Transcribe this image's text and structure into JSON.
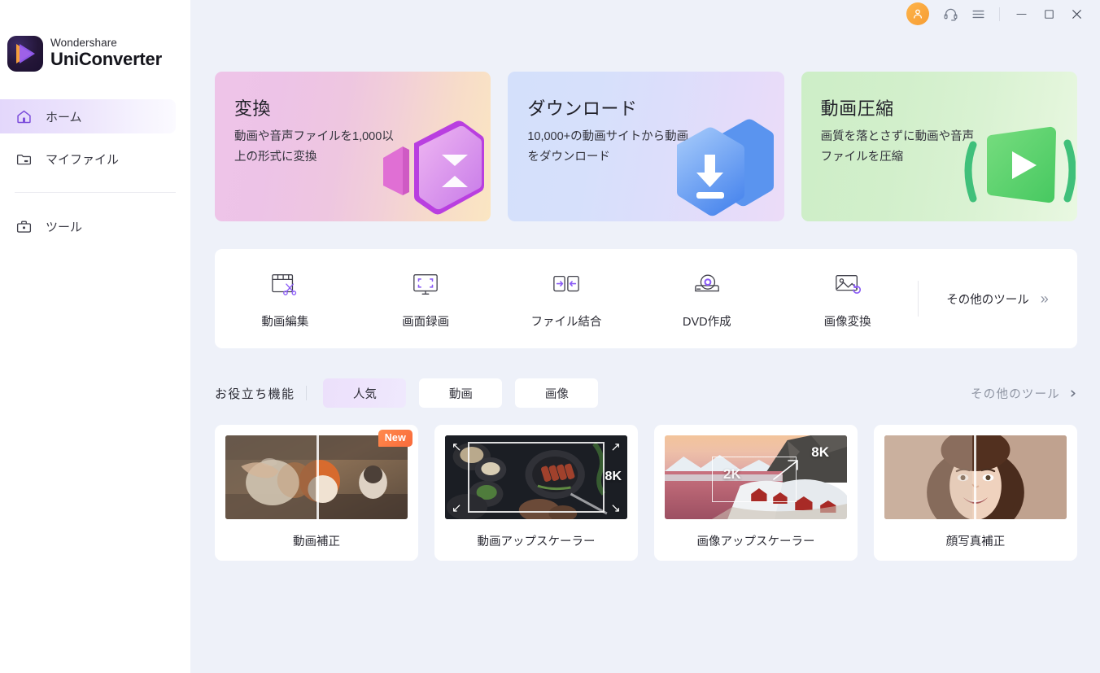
{
  "app": {
    "brand_top": "Wondershare",
    "brand_bottom": "UniConverter",
    "background_color": "#eef1f9",
    "accent_color": "#8b5cf6"
  },
  "titlebar": {
    "avatar_icon": "user-avatar-icon",
    "avatar_color": "#f9a53a",
    "support_icon": "headset-icon",
    "menu_icon": "hamburger-menu-icon",
    "minimize_icon": "minimize-icon",
    "maximize_icon": "maximize-icon",
    "close_icon": "close-icon"
  },
  "sidebar": {
    "items": [
      {
        "label": "ホーム",
        "icon": "home-icon",
        "active": true
      },
      {
        "label": "マイファイル",
        "icon": "folder-icon",
        "active": false
      },
      {
        "label": "ツール",
        "icon": "toolbox-icon",
        "active": false
      }
    ]
  },
  "feature_cards": [
    {
      "title": "変換",
      "desc": "動画や音声ファイルを1,000以上の形式に変換",
      "icon": "convert-icon",
      "color": "#eec4e8"
    },
    {
      "title": "ダウンロード",
      "desc": "10,000+の動画サイトから動画をダウンロード",
      "icon": "download-icon",
      "color": "#d4e0fb"
    },
    {
      "title": "動画圧縮",
      "desc": "画質を落とさずに動画や音声ファイルを圧縮",
      "icon": "compress-icon",
      "color": "#cdeec7"
    }
  ],
  "tools": [
    {
      "label": "動画編集",
      "icon": "video-edit-scissors-icon"
    },
    {
      "label": "画面録画",
      "icon": "screen-record-icon"
    },
    {
      "label": "ファイル結合",
      "icon": "merge-files-icon"
    },
    {
      "label": "DVD作成",
      "icon": "dvd-burn-icon"
    },
    {
      "label": "画像変換",
      "icon": "image-convert-icon"
    }
  ],
  "more_tools_button": {
    "label": "その他のツール",
    "icon": "double-chevron-right-icon"
  },
  "filter_bar": {
    "title": "お役立ち機能",
    "chips": [
      {
        "label": "人気",
        "active": true
      },
      {
        "label": "動画",
        "active": false
      },
      {
        "label": "画像",
        "active": false
      }
    ],
    "more_link": {
      "label": "その他のツール",
      "icon": "chevron-right-icon"
    }
  },
  "feature_grid": [
    {
      "label": "動画補正",
      "badge": "New",
      "thumb": "cat-before-after-thumbnail",
      "overlay": []
    },
    {
      "label": "動画アップスケーラー",
      "badge": null,
      "thumb": "food-upscale-thumbnail",
      "overlay": [
        "8K"
      ]
    },
    {
      "label": "画像アップスケーラー",
      "badge": null,
      "thumb": "mountain-upscale-thumbnail",
      "overlay": [
        "2K",
        "8K"
      ]
    },
    {
      "label": "顔写真補正",
      "badge": null,
      "thumb": "portrait-before-after-thumbnail",
      "overlay": []
    }
  ]
}
